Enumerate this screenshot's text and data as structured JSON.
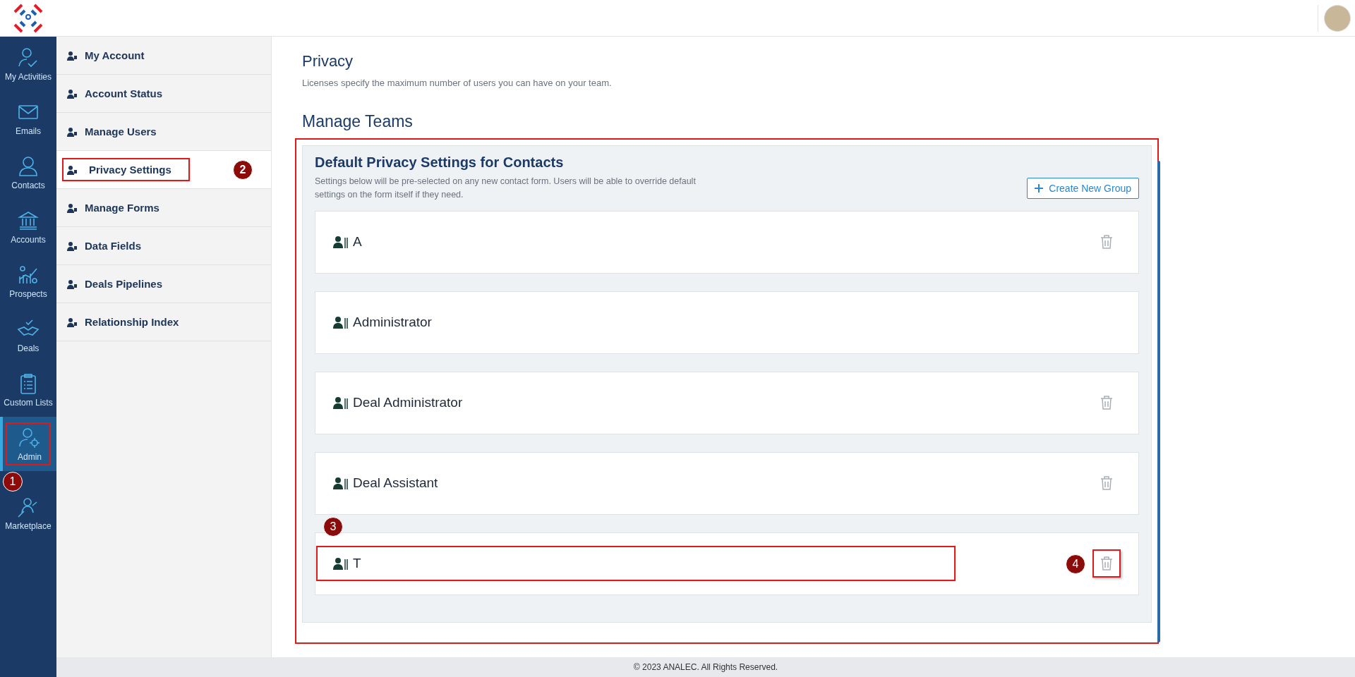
{
  "rail": [
    {
      "label": "My Activities",
      "selected": false,
      "outlined": false
    },
    {
      "label": "Emails",
      "selected": false,
      "outlined": false
    },
    {
      "label": "Contacts",
      "selected": false,
      "outlined": false
    },
    {
      "label": "Accounts",
      "selected": false,
      "outlined": false
    },
    {
      "label": "Prospects",
      "selected": false,
      "outlined": false
    },
    {
      "label": "Deals",
      "selected": false,
      "outlined": false
    },
    {
      "label": "Custom Lists",
      "selected": false,
      "outlined": false
    },
    {
      "label": "Admin",
      "selected": true,
      "outlined": true,
      "callout": "1"
    },
    {
      "label": "Marketplace",
      "selected": false,
      "outlined": false
    }
  ],
  "submenu": [
    {
      "label": "My Account",
      "selected": false,
      "outlined": false
    },
    {
      "label": "Account Status",
      "selected": false,
      "outlined": false
    },
    {
      "label": "Manage Users",
      "selected": false,
      "outlined": false
    },
    {
      "label": "Privacy Settings",
      "selected": true,
      "outlined": true,
      "callout": "2"
    },
    {
      "label": "Manage Forms",
      "selected": false,
      "outlined": false
    },
    {
      "label": "Data Fields",
      "selected": false,
      "outlined": false
    },
    {
      "label": "Deals Pipelines",
      "selected": false,
      "outlined": false
    },
    {
      "label": "Relationship Index",
      "selected": false,
      "outlined": false
    }
  ],
  "page": {
    "title": "Privacy",
    "subtitle": "Licenses specify the maximum number of users you can have on your team.",
    "section_title": "Manage Teams"
  },
  "card": {
    "title": "Default Privacy Settings for Contacts",
    "description": "Settings below will be pre-selected on any new contact form. Users will be able to override default settings on the form itself if they need.",
    "button": "Create New Group",
    "outlined": true,
    "groups": [
      {
        "name": "A",
        "deletable": true,
        "name_outlined": false,
        "delete_outlined": false
      },
      {
        "name": "Administrator",
        "deletable": false,
        "name_outlined": false
      },
      {
        "name": "Deal Administrator",
        "deletable": true,
        "name_outlined": false,
        "delete_outlined": false
      },
      {
        "name": "Deal Assistant",
        "deletable": true,
        "name_outlined": false,
        "delete_outlined": false
      },
      {
        "name": "T",
        "deletable": true,
        "name_outlined": true,
        "delete_outlined": true,
        "name_callout": "3",
        "delete_callout": "4"
      }
    ]
  },
  "footer": "© 2023 ANALEC. All Rights Reserved."
}
